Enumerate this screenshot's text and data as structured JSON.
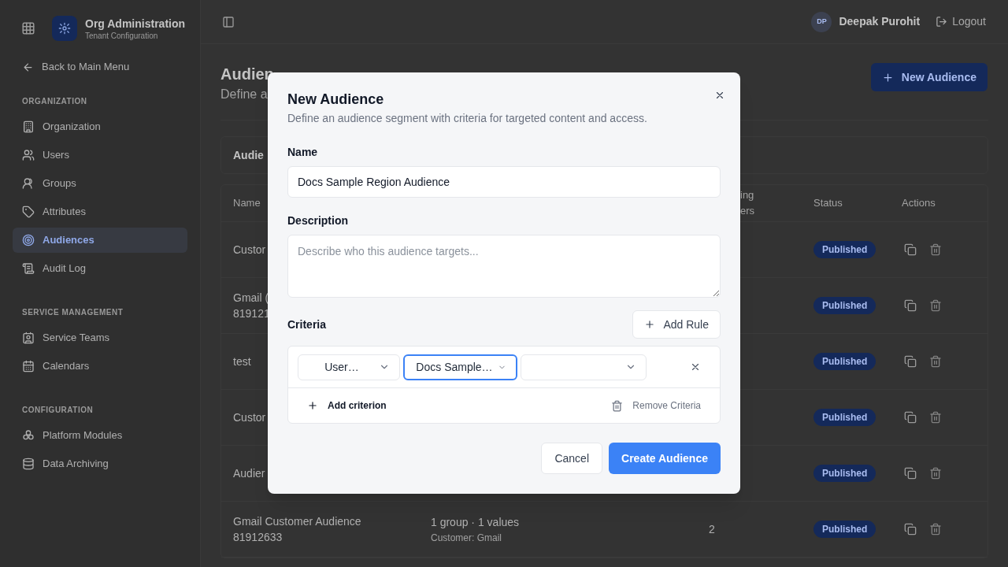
{
  "app": {
    "title": "Org Administration",
    "subtitle": "Tenant Configuration"
  },
  "sidebar": {
    "back": "Back to Main Menu",
    "sections": [
      {
        "heading": "ORGANIZATION",
        "items": [
          {
            "label": "Organization",
            "selected": false
          },
          {
            "label": "Users",
            "selected": false
          },
          {
            "label": "Groups",
            "selected": false
          },
          {
            "label": "Attributes",
            "selected": false
          },
          {
            "label": "Audiences",
            "selected": true
          },
          {
            "label": "Audit Log",
            "selected": false
          }
        ]
      },
      {
        "heading": "SERVICE MANAGEMENT",
        "items": [
          {
            "label": "Service Teams",
            "selected": false
          },
          {
            "label": "Calendars",
            "selected": false
          }
        ]
      },
      {
        "heading": "CONFIGURATION",
        "items": [
          {
            "label": "Platform Modules",
            "selected": false
          },
          {
            "label": "Data Archiving",
            "selected": false
          }
        ]
      }
    ]
  },
  "header": {
    "avatar": "DP",
    "user": "Deepak Purohit",
    "logout": "Logout"
  },
  "page": {
    "title": "Audien",
    "subtitle": "Define a",
    "new_button": "New Audience"
  },
  "table": {
    "card_title": "Audie",
    "columns": [
      {
        "lines": [
          "Name"
        ]
      },
      {},
      {
        "lines": [
          "ing",
          "ers"
        ]
      },
      {
        "lines": [
          "Status"
        ]
      },
      {
        "lines": [
          "Actions"
        ]
      }
    ],
    "rows": [
      {
        "name": [
          "Custor"
        ],
        "status": "Published"
      },
      {
        "name": [
          "Gmail (",
          "819121"
        ],
        "status": "Published"
      },
      {
        "name": [
          "test"
        ],
        "status": "Published"
      },
      {
        "name": [
          "Custor"
        ],
        "status": "Published"
      },
      {
        "name": [
          "Audier"
        ],
        "status": "Published"
      },
      {
        "name": [
          "Gmail Customer Audience",
          "81912633"
        ],
        "criteria": [
          "1 group · 1 values",
          "Customer: Gmail"
        ],
        "members": "2",
        "status": "Published"
      }
    ]
  },
  "modal": {
    "title": "New Audience",
    "description": "Define an audience segment with criteria for targeted content and access.",
    "name_label": "Name",
    "name_value": "Docs Sample Region Audience",
    "description_label": "Description",
    "description_placeholder": "Describe who this audience targets...",
    "criteria_label": "Criteria",
    "add_rule": "Add Rule",
    "criteria": [
      {
        "selects": [
          {
            "value": "User…",
            "focused": false
          },
          {
            "value": "Docs Sample…",
            "focused": true
          },
          {
            "focused": false
          }
        ]
      }
    ],
    "add_criterion": "Add criterion",
    "remove_criteria": "Remove Criteria",
    "cancel": "Cancel",
    "create": "Create Audience"
  }
}
